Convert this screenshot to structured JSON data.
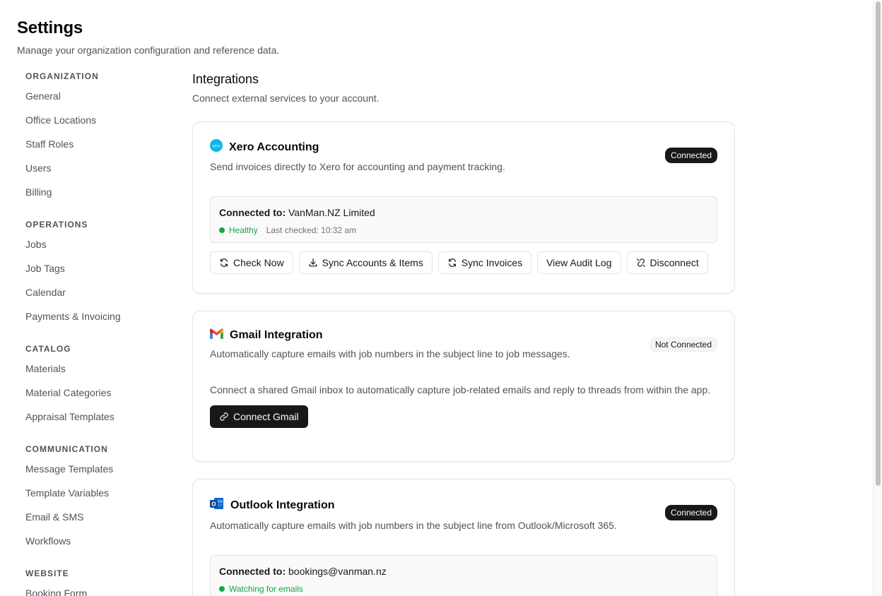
{
  "header": {
    "title": "Settings",
    "subtitle": "Manage your organization configuration and reference data."
  },
  "sidebar": {
    "groups": [
      {
        "heading": "ORGANIZATION",
        "items": [
          "General",
          "Office Locations",
          "Staff Roles",
          "Users",
          "Billing"
        ]
      },
      {
        "heading": "OPERATIONS",
        "items": [
          "Jobs",
          "Job Tags",
          "Calendar",
          "Payments & Invoicing"
        ]
      },
      {
        "heading": "CATALOG",
        "items": [
          "Materials",
          "Material Categories",
          "Appraisal Templates"
        ]
      },
      {
        "heading": "COMMUNICATION",
        "items": [
          "Message Templates",
          "Template Variables",
          "Email & SMS",
          "Workflows"
        ]
      },
      {
        "heading": "WEBSITE",
        "items": [
          "Booking Form"
        ]
      }
    ]
  },
  "main": {
    "title": "Integrations",
    "subtitle": "Connect external services to your account.",
    "xero": {
      "title": "Xero Accounting",
      "description": "Send invoices directly to Xero for accounting and payment tracking.",
      "status": "Connected",
      "connected_label": "Connected to:",
      "connected_value": "VanMan.NZ Limited",
      "health": "Healthy",
      "last_checked": "Last checked: 10:32 am",
      "buttons": {
        "check_now": "Check Now",
        "sync_accounts": "Sync Accounts & Items",
        "sync_invoices": "Sync Invoices",
        "audit_log": "View Audit Log",
        "disconnect": "Disconnect"
      },
      "logo_color": "#13b5ea"
    },
    "gmail": {
      "title": "Gmail Integration",
      "description": "Automatically capture emails with job numbers in the subject line to job messages.",
      "status": "Not Connected",
      "body": "Connect a shared Gmail inbox to automatically capture job-related emails and reply to threads from within the app.",
      "connect_button": "Connect Gmail"
    },
    "outlook": {
      "title": "Outlook Integration",
      "description": "Automatically capture emails with job numbers in the subject line from Outlook/Microsoft 365.",
      "status": "Connected",
      "connected_label": "Connected to:",
      "connected_value": "bookings@vanman.nz",
      "watch_status": "Watching for emails"
    }
  },
  "colors": {
    "accent": "#18181b",
    "healthy": "#16a34a"
  }
}
